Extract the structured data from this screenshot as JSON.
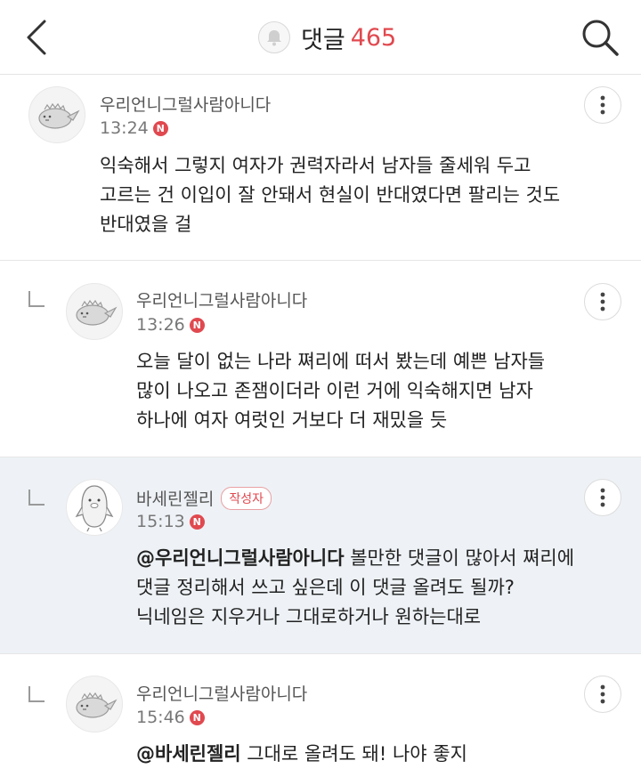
{
  "header": {
    "title": "댓글",
    "count": "465",
    "icons": {
      "back": "chevron-left-icon",
      "bell": "bell-icon",
      "search": "search-icon"
    }
  },
  "colors": {
    "accent": "#e0494f",
    "highlight_bg": "#eef2f6",
    "divider": "#e6e6e6"
  },
  "comments": [
    {
      "nickname": "우리언니그럴사람아니다",
      "time": "13:24",
      "new_badge": "N",
      "lines": [
        "익숙해서 그렇지 여자가 권력자라서 남자들 줄세워 두고",
        "고르는 건 이입이 잘 안돼서 현실이 반대였다면 팔리는 것도",
        "반대였을 걸"
      ]
    },
    {
      "nickname": "우리언니그럴사람아니다",
      "time": "13:26",
      "new_badge": "N",
      "lines": [
        "오늘 달이 없는 나라 쪄리에 떠서 봤는데 예쁜 남자들",
        "많이 나오고 존잼이더라 이런 거에 익숙해지면 남자",
        "하나에 여자 여럿인 거보다 더 재밌을 듯"
      ]
    },
    {
      "nickname": "바세린젤리",
      "author_badge": "작성자",
      "time": "15:13",
      "new_badge": "N",
      "mention": "@우리언니그럴사람아니다",
      "lines": [
        " 볼만한 댓글이 많아서 쪄리에",
        "댓글 정리해서 쓰고 싶은데 이 댓글 올려도 될까?",
        "닉네임은 지우거나 그대로하거나 원하는대로"
      ]
    },
    {
      "nickname": "우리언니그럴사람아니다",
      "time": "15:46",
      "new_badge": "N",
      "mention": "@바세린젤리",
      "lines": [
        " 그대로 올려도 돼! 나야 좋지"
      ]
    }
  ]
}
